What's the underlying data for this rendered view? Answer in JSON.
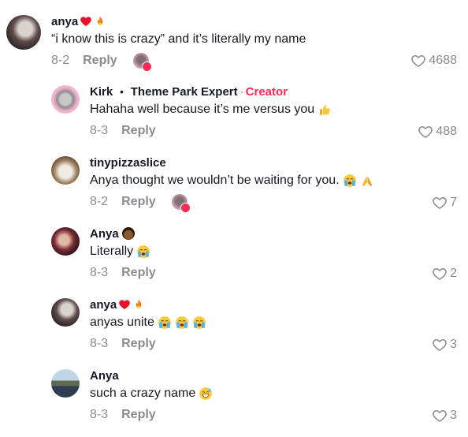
{
  "comments": [
    {
      "name": "anya",
      "text": "“i know this is crazy” and it’s literally my name",
      "date": "8-2",
      "reply": "Reply",
      "likes": "4688"
    },
    {
      "name": "Kirk",
      "title": "Theme Park Expert",
      "sep": "·",
      "badge": "Creator",
      "text": "Hahaha well because it’s me versus you",
      "date": "8-3",
      "reply": "Reply",
      "likes": "488"
    },
    {
      "name": "tinypizzaslice",
      "text": "Anya thought we wouldn’t be waiting for you.",
      "date": "8-2",
      "reply": "Reply",
      "likes": "7"
    },
    {
      "name": "Anya",
      "text": "Literally",
      "date": "8-3",
      "reply": "Reply",
      "likes": "2"
    },
    {
      "name": "anya",
      "text": "anyas unite",
      "date": "8-3",
      "reply": "Reply",
      "likes": "3"
    },
    {
      "name": "Anya",
      "text": "such a crazy name",
      "date": "8-3",
      "reply": "Reply",
      "likes": "3"
    }
  ],
  "colors": {
    "creator": "#fe2c55",
    "muted": "#8a8b91",
    "text": "#161823"
  },
  "icons": [
    "heart-outline-icon",
    "red-heart-emoji",
    "fire-emoji",
    "thumbs-up-emoji",
    "loudly-crying-emoji",
    "folded-hands-emoji",
    "grinning-sweat-emoji"
  ]
}
